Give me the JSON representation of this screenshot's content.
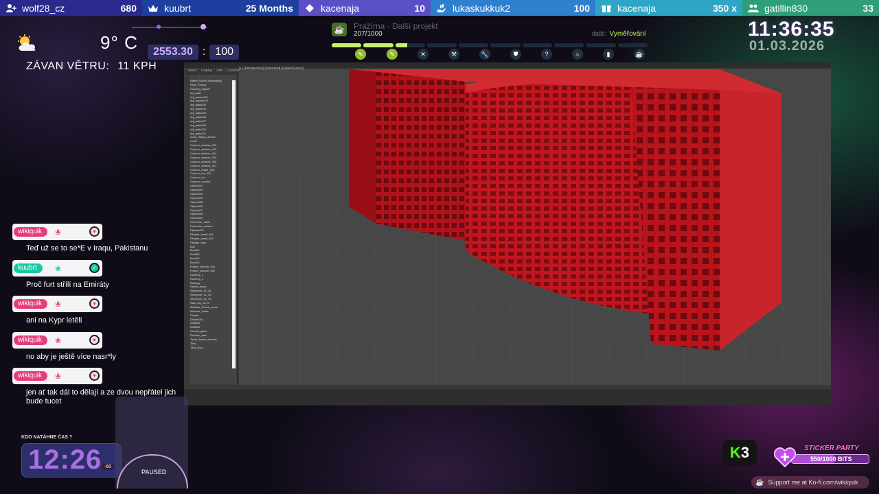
{
  "topbar": [
    {
      "icon": "follower-icon",
      "name": "wolf28_cz",
      "value": "680",
      "color": "#2a2a8c"
    },
    {
      "icon": "crown-icon",
      "name": "kuubrt",
      "value": "25 Months",
      "color": "#1e3fa0"
    },
    {
      "icon": "diamond-icon",
      "name": "kacenaja",
      "value": "10",
      "color": "#5a4fc7"
    },
    {
      "icon": "hand-icon",
      "name": "lukaskukkuk2",
      "value": "100",
      "color": "#2f7fcf"
    },
    {
      "icon": "gift-icon",
      "name": "kacenaja",
      "value": "350 x",
      "color": "#2ea5c4"
    },
    {
      "icon": "community-icon",
      "name": "gatillin830",
      "value": "33",
      "color": "#2f9e7b"
    }
  ],
  "weather": {
    "icon": "partly-cloudy-icon",
    "temperature": "9° C",
    "wind_label": "ZÁVAN VĚTRU:",
    "wind_value": "11 KPH"
  },
  "balance": {
    "a": "2553.30",
    "sep": ":",
    "b": "100"
  },
  "project": {
    "title": "Pražírna - Další projekt",
    "count": "207/1000",
    "next_label": "další:",
    "next_value": "Vyměřování",
    "progress": 0.21,
    "accent": "#c8f26a"
  },
  "clock": {
    "time": "11:36:35",
    "date": "01.03.2026"
  },
  "max": {
    "tabs": [
      "Select",
      "Display",
      "Edit",
      "Customize"
    ],
    "viewport_label": "[+] [Perspective] [Standard] [Edged Faces]",
    "explorer_items": [
      "Name (Sorted Ascending)",
      "Roof_Roomy",
      "Housing_square",
      "obj_patio",
      "obj_pracky001",
      "obj_pracky002",
      "obj_patio003",
      "obj_patio004",
      "obj_patio005",
      "obj_patio006",
      "obj_patio007",
      "obj_patio008",
      "obj_patio009",
      "obj_patio010",
      "Zone_Siding_double",
      "Lout1",
      "Column_window_002",
      "Column_window_003",
      "Column_window_004",
      "Column_window_005",
      "Column_window_006",
      "Column_window_007",
      "Column_Wider_005",
      "Column_out_001",
      "Column_out",
      "Column_corridor",
      "Object001",
      "Object002",
      "Object003",
      "Object004",
      "Object005",
      "Object006",
      "Object007",
      "Object008",
      "Object009",
      "Perimeter_stairs",
      "Perimeter_column",
      "Pilaster001",
      "Pilaster_small_001",
      "Pilaster_small_002",
      "Pilaster_bars",
      "Box",
      "Box001",
      "Box002",
      "Box003",
      "Box004",
      "Frame_corridor_001",
      "Frame_corridor_002",
      "RoofTop_1",
      "RoofTop_2",
      "Railings",
      "Safety_brace",
      "Storyfront_01_01",
      "Storyfront_01_02",
      "Storyfront_01_03",
      "Slab_top_curve",
      "Window_Frame_curve",
      "Window_Glass",
      "Divider",
      "Divider001",
      "Wall001",
      "Wall002",
      "Curved_glass",
      "Rooftop_slab",
      "Tower_frame_window",
      "Tiles",
      "Tiles_floor"
    ]
  },
  "chat": [
    {
      "user": "wikiquik",
      "style": "pink",
      "badge": "heart",
      "text": "Teď už se to se*E v Iraqu, Pakistanu"
    },
    {
      "user": "kuubrt",
      "style": "green",
      "badge": "check",
      "text": "Proč furt střílí na Emiráty"
    },
    {
      "user": "wikiquik",
      "style": "pink",
      "badge": "heart",
      "text": "ani na Kypr letěli"
    },
    {
      "user": "wikiquik",
      "style": "pink",
      "badge": "heart",
      "text": "no aby je ještě více nasr*ly"
    },
    {
      "user": "wikiquik",
      "style": "pink",
      "badge": "heart",
      "text": "jen ať tak dál to dělají a ze dvou nepřátel jich bude tucet"
    }
  ],
  "countdown": {
    "label": "KDO NATÁHNE ČAS ?",
    "time": "12:26",
    "pill": "-60"
  },
  "paused": {
    "label": "PAUSED"
  },
  "k3": {
    "k": "K",
    "n": "3"
  },
  "sticker": {
    "title": "STICKER PARTY",
    "bits": "550/1000 BITS",
    "progress": 0.55
  },
  "kofi": {
    "text": "Support me at Ko-fi.com/wikiquik"
  }
}
